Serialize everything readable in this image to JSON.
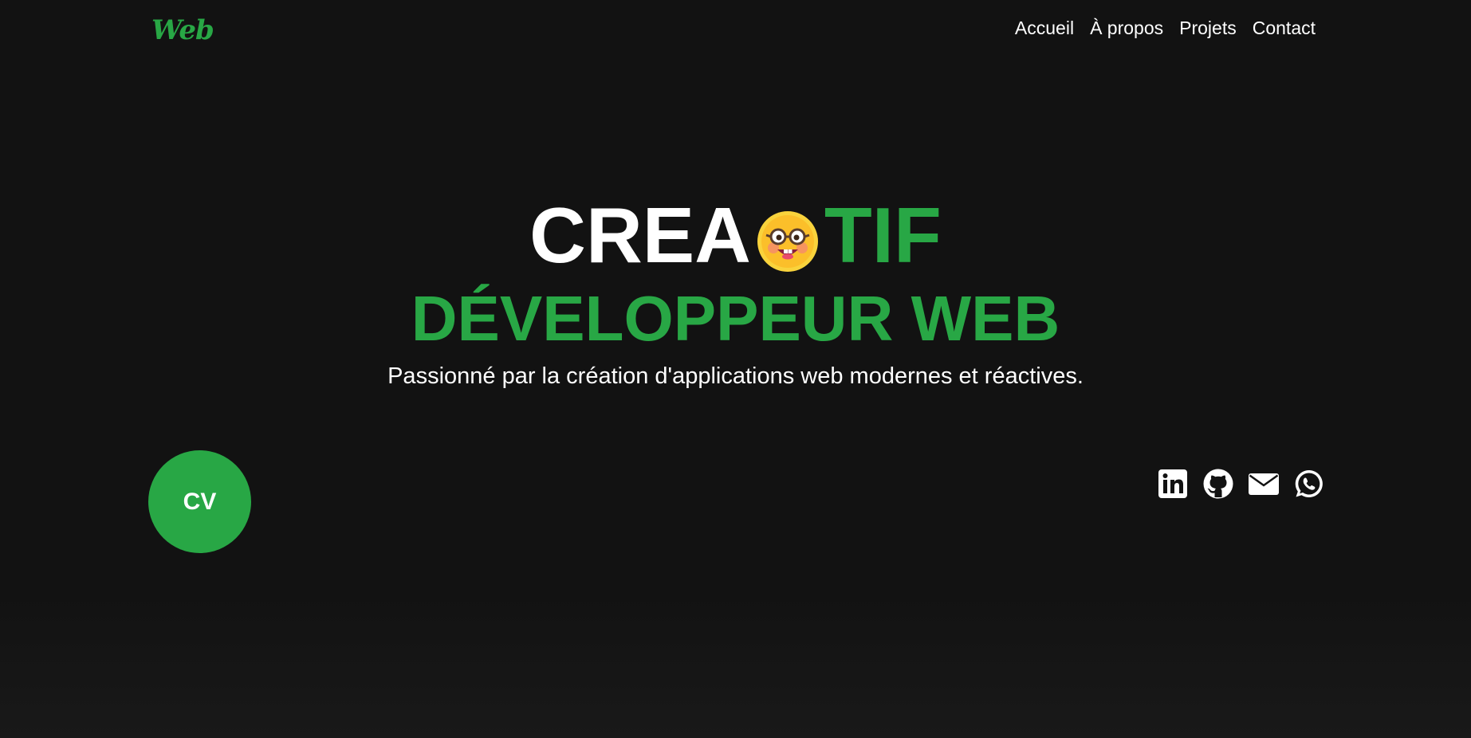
{
  "header": {
    "logo": "Web",
    "nav": [
      "Accueil",
      "À propos",
      "Projets",
      "Contact"
    ]
  },
  "hero": {
    "headline_part1": "CREA",
    "headline_emoji": "nerd-face-emoji",
    "headline_part2": "TIF",
    "role": "DÉVELOPPEUR WEB",
    "tagline": "Passionné par la création d'applications web modernes et réactives."
  },
  "cv_button": {
    "label": "CV"
  },
  "socials": [
    "linkedin-icon",
    "github-icon",
    "email-icon",
    "whatsapp-icon"
  ],
  "colors": {
    "background": "#121212",
    "accent": "#28a745",
    "text": "#ffffff"
  }
}
